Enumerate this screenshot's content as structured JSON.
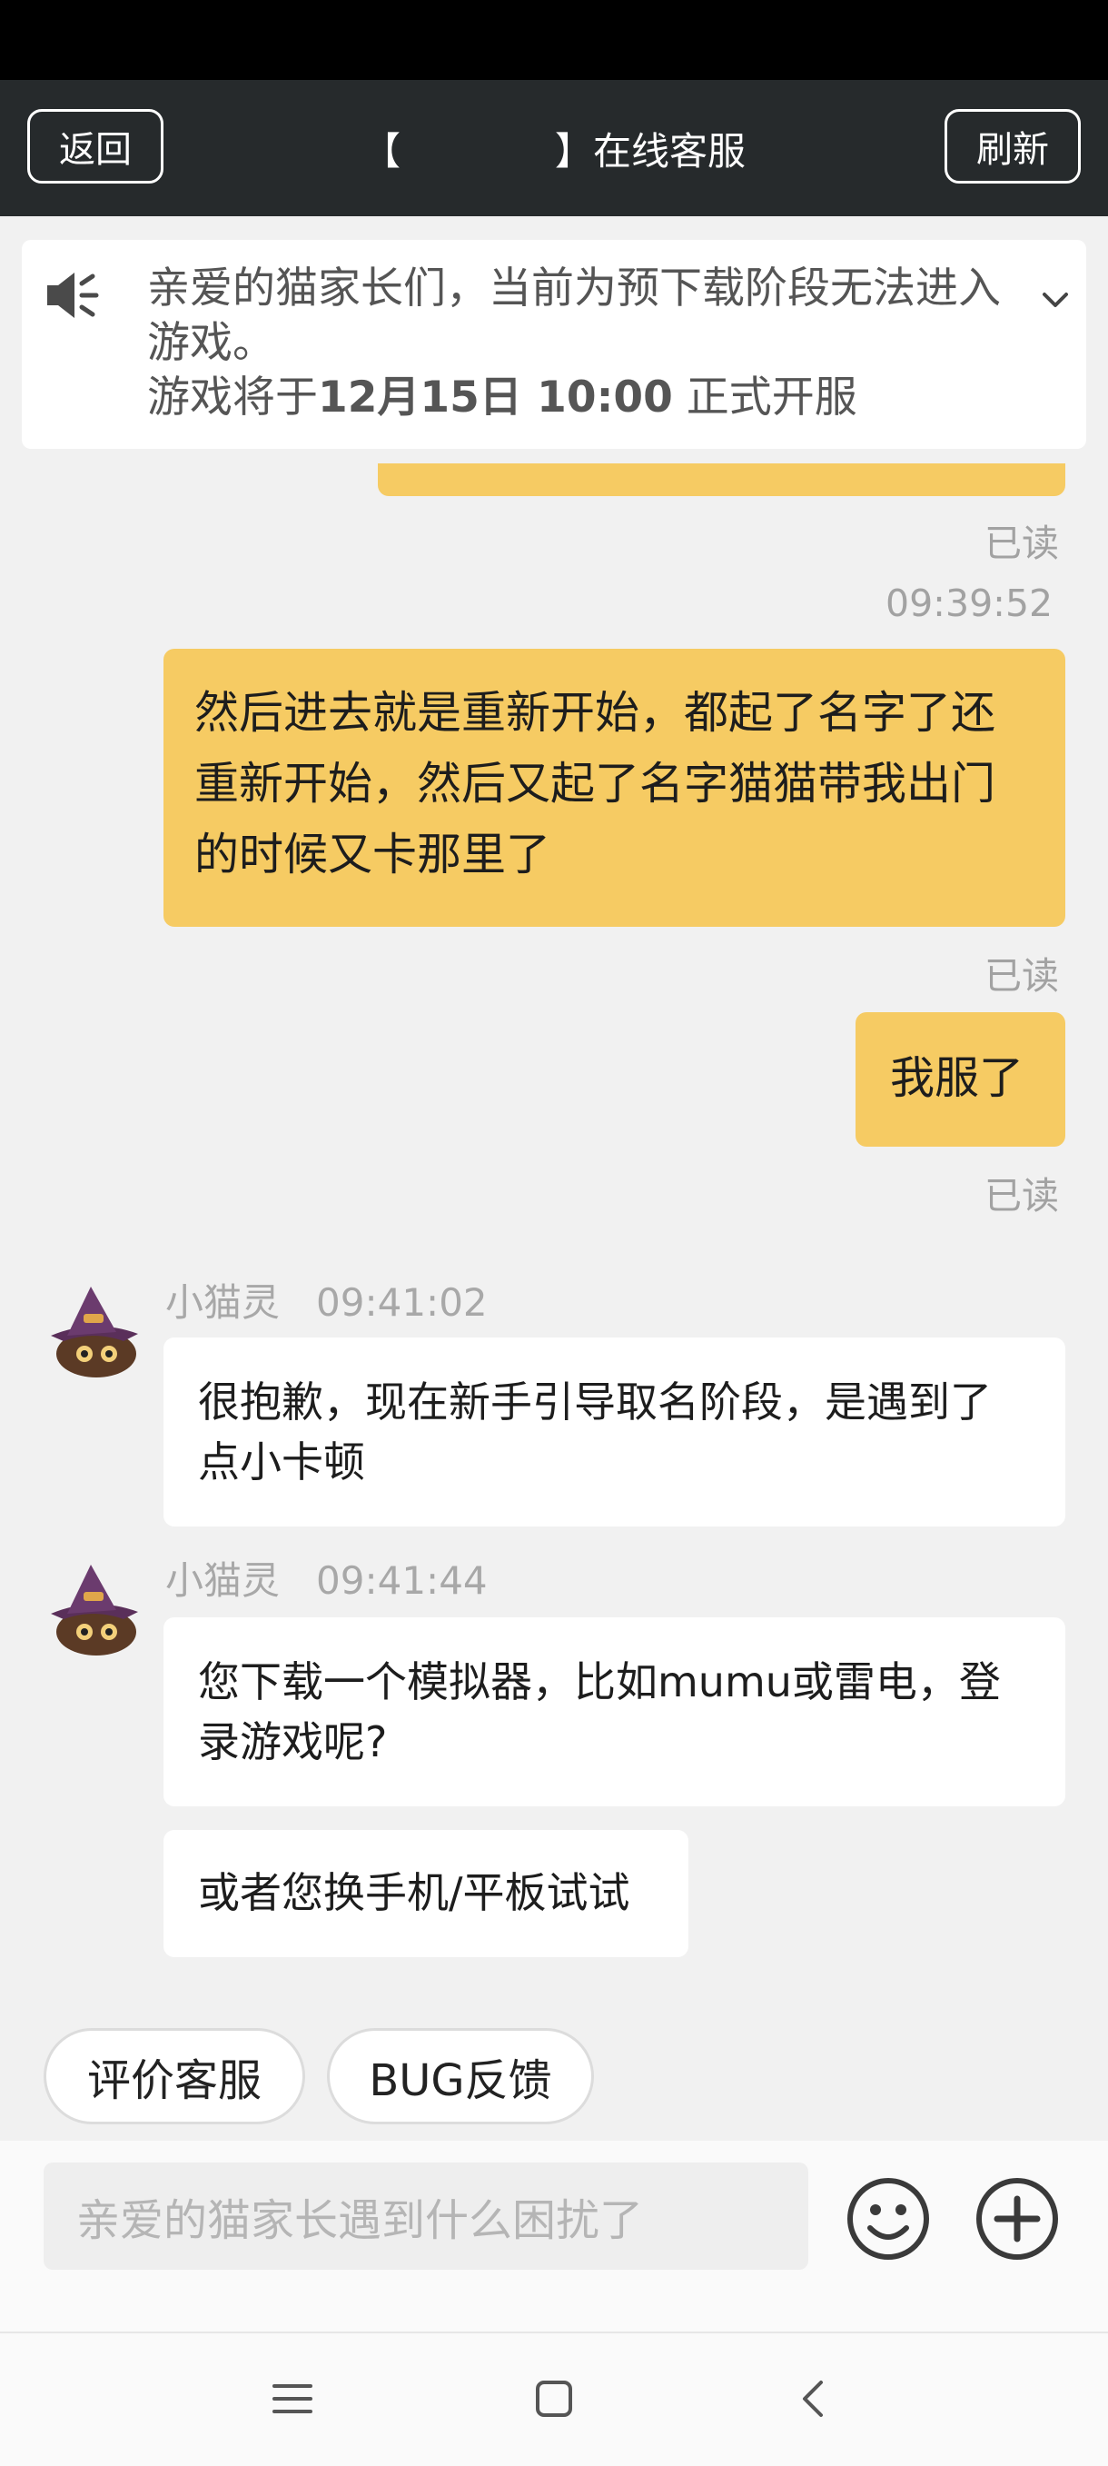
{
  "header": {
    "back_label": "返回",
    "title_open": "【",
    "title_close": "】在线客服",
    "refresh_label": "刷新"
  },
  "notice": {
    "line1": "亲爱的猫家长们，当前为预下载阶段无法进入游戏。",
    "line2_prefix": "游戏将于",
    "line2_bold": "12月15日 10:00",
    "line2_suffix": " 正式开服"
  },
  "messages": {
    "read_label": "已读",
    "time_1": "09:39:52",
    "user_msg_1": "然后进去就是重新开始，都起了名字了还重新开始，然后又起了名字猫猫带我出门的时候又卡那里了",
    "user_msg_2": "我服了",
    "agent_name": "小猫灵",
    "agent_time_1": "09:41:02",
    "agent_msg_1": "很抱歉，现在新手引导取名阶段，是遇到了点小卡顿",
    "agent_time_2": "09:41:44",
    "agent_msg_2": "您下载一个模拟器，比如mumu或雷电，登录游戏呢?",
    "agent_msg_3": "或者您换手机/平板试试"
  },
  "quick_actions": {
    "rate": "评价客服",
    "bug": "BUG反馈"
  },
  "composer": {
    "placeholder": "亲爱的猫家长遇到什么困扰了"
  },
  "colors": {
    "user_bubble": "#f6cb63",
    "header_bg": "#262a2c",
    "page_bg": "#f1f1f1"
  }
}
